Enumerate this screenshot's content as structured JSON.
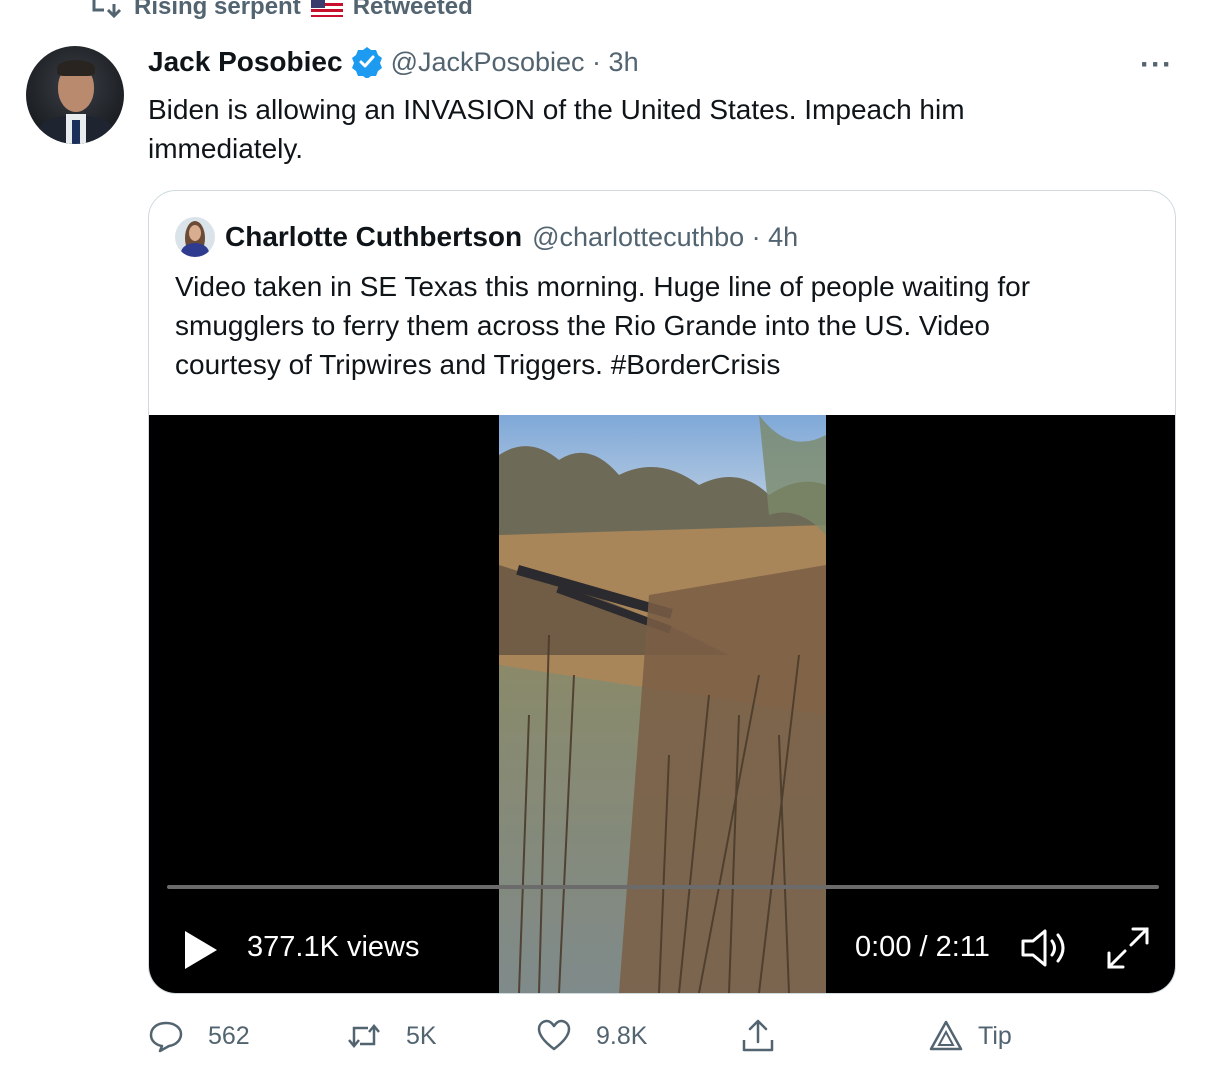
{
  "retweet_header": {
    "icon": "retweet-icon",
    "retweeter": "Rising serpent",
    "flag": "us-flag-emoji",
    "action": "Retweeted"
  },
  "tweet": {
    "author_name": "Jack Posobiec",
    "verified_icon": "verified-badge-icon",
    "handle_time": "@JackPosobiec · 3h",
    "more": "···",
    "text_line1": "Biden is allowing an INVASION of the United States. Impeach him",
    "text_line2": "immediately."
  },
  "quoted_tweet": {
    "author_name": "Charlotte Cuthbertson",
    "handle_time": "@charlottecuthbo · 4h",
    "text_line1": "Video taken in SE Texas this morning. Huge line of people waiting for",
    "text_line2": "smugglers to ferry them across the Rio Grande into the US. Video",
    "text_line3": "courtesy of Tripwires and Triggers. #BorderCrisis"
  },
  "video": {
    "views": "377.1K views",
    "time": "0:00 / 2:11",
    "progress": 0,
    "controls": [
      "play-icon",
      "volume-icon",
      "fullscreen-icon"
    ]
  },
  "actions": {
    "reply_count": "562",
    "retweet_count": "5K",
    "like_count": "9.8K",
    "tip_label": "Tip"
  },
  "colors": {
    "text_primary": "#0f1419",
    "text_secondary": "#536471",
    "verified": "#1d9bf0",
    "border": "#cfd9de"
  }
}
